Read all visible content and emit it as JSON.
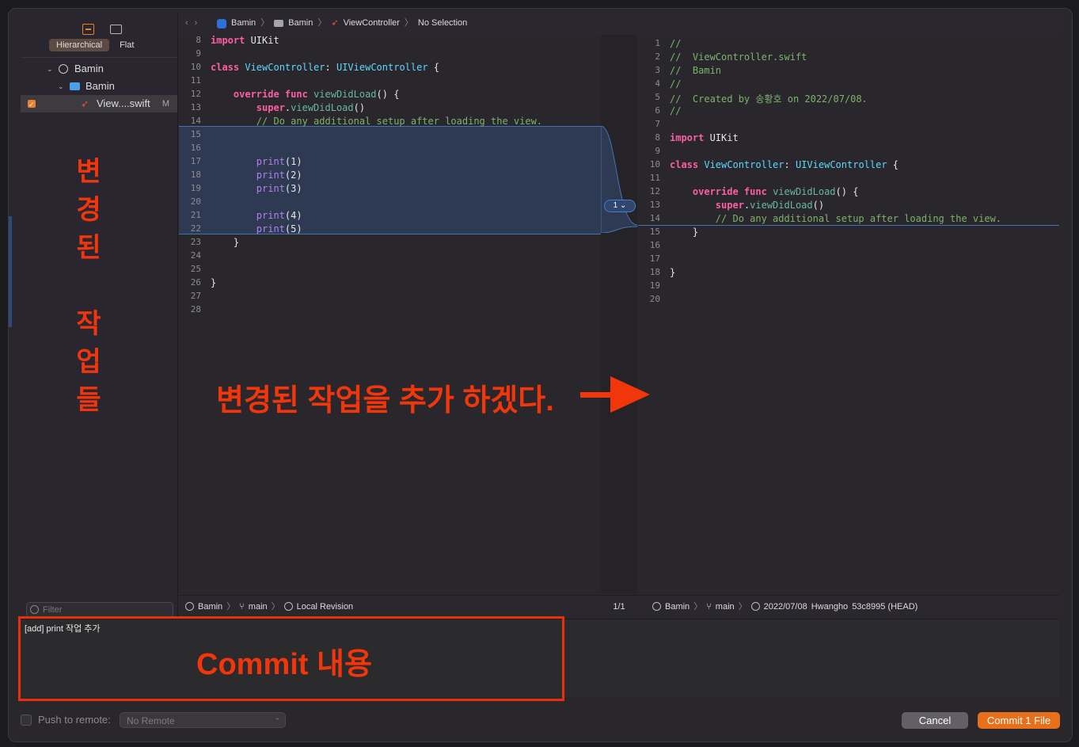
{
  "sidebar": {
    "seg_hierarchical": "Hierarchical",
    "seg_flat": "Flat",
    "tree": [
      {
        "label": "Bamin"
      },
      {
        "label": "Bamin"
      },
      {
        "label": "View....swift",
        "badge": "M"
      }
    ],
    "filter_placeholder": "Filter",
    "annotation_vertical": [
      "변",
      "경",
      "된",
      "",
      "작",
      "업",
      "들"
    ]
  },
  "breadcrumb": {
    "items": [
      "Bamin",
      "Bamin",
      "ViewController",
      "No Selection"
    ]
  },
  "left_pane": {
    "lines": [
      {
        "n": "8",
        "html": "<span class=\"kw\">import</span> UIKit"
      },
      {
        "n": "9",
        "html": ""
      },
      {
        "n": "10",
        "html": "<span class=\"kw\">class</span> <span class=\"ty\">ViewController</span>: <span class=\"ty\">UIViewController</span> {"
      },
      {
        "n": "11",
        "html": ""
      },
      {
        "n": "12",
        "html": "    <span class=\"kw\">override func</span> <span class=\"fn\">viewDidLoad</span>() {"
      },
      {
        "n": "13",
        "html": "        <span class=\"kw\">super</span>.<span class=\"fn\">viewDidLoad</span>()"
      },
      {
        "n": "14",
        "html": "        <span class=\"cm\">// Do any additional setup after loading the view.</span>"
      },
      {
        "n": "15",
        "html": ""
      },
      {
        "n": "16",
        "html": ""
      },
      {
        "n": "17",
        "html": "        <span class=\"pr\">print</span>(1)"
      },
      {
        "n": "18",
        "html": "        <span class=\"pr\">print</span>(2)"
      },
      {
        "n": "19",
        "html": "        <span class=\"pr\">print</span>(3)"
      },
      {
        "n": "20",
        "html": ""
      },
      {
        "n": "21",
        "html": "        <span class=\"pr\">print</span>(4)"
      },
      {
        "n": "22",
        "html": "        <span class=\"pr\">print</span>(5)"
      },
      {
        "n": "23",
        "html": "    }"
      },
      {
        "n": "24",
        "html": ""
      },
      {
        "n": "25",
        "html": ""
      },
      {
        "n": "26",
        "html": "}"
      },
      {
        "n": "27",
        "html": ""
      },
      {
        "n": "28",
        "html": ""
      }
    ],
    "bottom": {
      "repo": "Bamin",
      "branch": "main",
      "revision": "Local Revision"
    }
  },
  "change_count": "1",
  "pager": "1/1",
  "right_pane": {
    "lines": [
      {
        "n": "1",
        "html": "<span class=\"cm\">//</span>"
      },
      {
        "n": "2",
        "html": "<span class=\"cm\">//  ViewController.swift</span>"
      },
      {
        "n": "3",
        "html": "<span class=\"cm\">//  Bamin</span>"
      },
      {
        "n": "4",
        "html": "<span class=\"cm\">//</span>"
      },
      {
        "n": "5",
        "html": "<span class=\"cm\">//  Created by 송황호 on 2022/07/08.</span>"
      },
      {
        "n": "6",
        "html": "<span class=\"cm\">//</span>"
      },
      {
        "n": "7",
        "html": ""
      },
      {
        "n": "8",
        "html": "<span class=\"kw\">import</span> UIKit"
      },
      {
        "n": "9",
        "html": ""
      },
      {
        "n": "10",
        "html": "<span class=\"kw\">class</span> <span class=\"ty\">ViewController</span>: <span class=\"ty\">UIViewController</span> {"
      },
      {
        "n": "11",
        "html": ""
      },
      {
        "n": "12",
        "html": "    <span class=\"kw\">override func</span> <span class=\"fn\">viewDidLoad</span>() {"
      },
      {
        "n": "13",
        "html": "        <span class=\"kw\">super</span>.<span class=\"fn\">viewDidLoad</span>()"
      },
      {
        "n": "14",
        "html": "        <span class=\"cm\">// Do any additional setup after loading the view.</span>"
      },
      {
        "n": "15",
        "html": "    }"
      },
      {
        "n": "16",
        "html": ""
      },
      {
        "n": "17",
        "html": ""
      },
      {
        "n": "18",
        "html": "}"
      },
      {
        "n": "19",
        "html": ""
      },
      {
        "n": "20",
        "html": ""
      }
    ],
    "bottom": {
      "repo": "Bamin",
      "branch": "main",
      "date": "2022/07/08",
      "author": "Hwangho",
      "commit": "53c8995 (HEAD)"
    }
  },
  "annotations": {
    "main": "변경된 작업을 추가 하겠다.",
    "commit_box": "Commit 내용"
  },
  "commit": {
    "message": "[add] print 작업 추가"
  },
  "footer": {
    "push_label": "Push to remote:",
    "remote_value": "No Remote",
    "cancel": "Cancel",
    "commit_button": "Commit 1 File"
  },
  "colors": {
    "accent": "#e8701a",
    "annotation_red": "#f1360c",
    "diff_blue": "#4372b4"
  }
}
